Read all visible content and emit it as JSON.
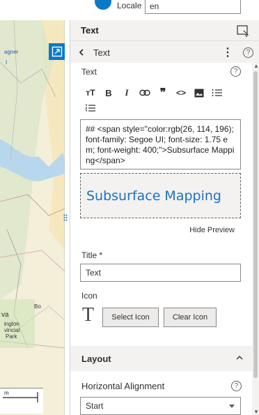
{
  "top": {
    "locale_label": "Locale",
    "locale_value": "en"
  },
  "map": {
    "labels": [
      "agner",
      "I",
      "Bo",
      "va",
      "ington",
      "vincial",
      "Park",
      "m"
    ]
  },
  "panel": {
    "title": "Text",
    "sub_title": "Text",
    "text_label": "Text",
    "toolbar": [
      "ᴛT",
      "B",
      "I",
      "⊖",
      "❞",
      "<>",
      "▣",
      "☰",
      "☰"
    ],
    "markdown": "## <span style=\"color:rgb(26, 114, 196); font-family: Segoe UI; font-size: 1.75 em; font-weight: 400;\">Subsurface Mapping</span>",
    "preview_text": "Subsurface Mapping",
    "hide_preview": "Hide Preview",
    "title_label": "Title *",
    "title_value": "Text",
    "icon_label": "Icon",
    "icon_glyph": "T",
    "select_icon": "Select Icon",
    "clear_icon": "Clear Icon",
    "layout_label": "Layout",
    "halign_label": "Horizontal Alignment",
    "halign_value": "Start"
  },
  "colors": {
    "accent": "#1a72c4",
    "brand_blue": "#0b79c9"
  }
}
